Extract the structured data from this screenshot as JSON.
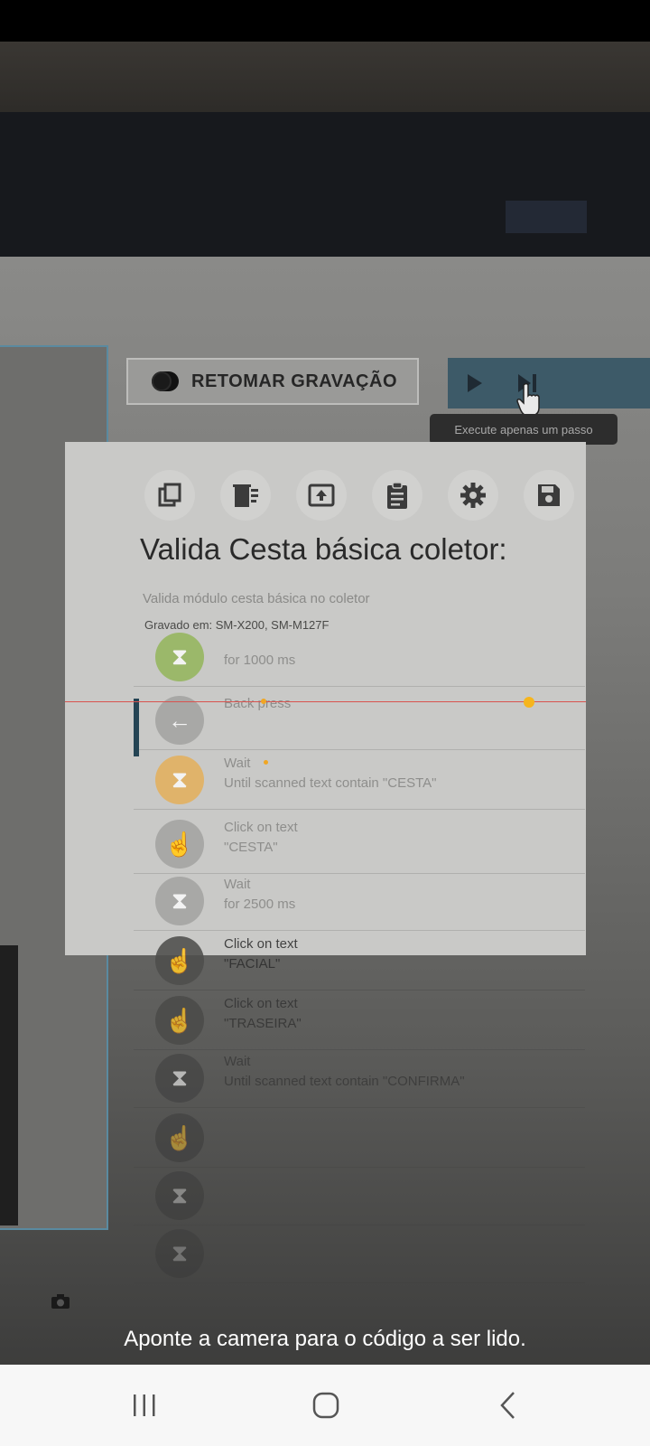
{
  "app": {
    "camera_prompt": "Aponte a camera para o código a ser lido."
  },
  "captured_screen": {
    "retomar_button_label": "RETOMAR GRAVAÇÃO",
    "tooltip": "Execute apenas um passo",
    "toolbar_icons": [
      "copy-icon",
      "delete-icon",
      "export-icon",
      "clipboard-icon",
      "settings-icon",
      "save-icon"
    ],
    "title": "Valida Cesta básica coletor:",
    "description": "Valida módulo cesta básica no coletor",
    "recorded_on": "Gravado em: SM-X200, SM-M127F",
    "steps": [
      {
        "title": "",
        "subtitle": "for 1000 ms",
        "icon": "hourglass-icon",
        "color": "#9bb86a"
      },
      {
        "title": "Back press",
        "subtitle": "",
        "icon": "back-arrow-icon",
        "color": "#a8a8a6"
      },
      {
        "title": "Wait",
        "subtitle": "Until scanned text contain \"CESTA\"",
        "icon": "hourglass-icon",
        "color": "#e0b36a"
      },
      {
        "title": "Click on text",
        "subtitle": "\"CESTA\"",
        "icon": "touch-icon",
        "color": "#a8a8a6"
      },
      {
        "title": "Wait",
        "subtitle": "for 2500 ms",
        "icon": "hourglass-icon",
        "color": "#a8a8a6"
      },
      {
        "title": "Click on text",
        "subtitle": "\"FACIAL\"",
        "icon": "touch-icon",
        "color": "#4e4e4c"
      },
      {
        "title": "Click on text",
        "subtitle": "\"TRASEIRA\"",
        "icon": "touch-icon",
        "color": "#484846"
      },
      {
        "title": "Wait",
        "subtitle": "Until scanned text contain \"CONFIRMA\"",
        "icon": "hourglass-icon",
        "color": "#404040"
      },
      {
        "title": "",
        "subtitle": "",
        "icon": "touch-icon",
        "color": "#383838"
      },
      {
        "title": "",
        "subtitle": "",
        "icon": "hourglass-icon",
        "color": "#323232"
      },
      {
        "title": "",
        "subtitle": "",
        "icon": "hourglass-icon",
        "color": "#2e2e2e"
      }
    ]
  },
  "nav_bar": {
    "buttons": [
      "recent-apps-icon",
      "home-icon",
      "back-icon"
    ]
  }
}
